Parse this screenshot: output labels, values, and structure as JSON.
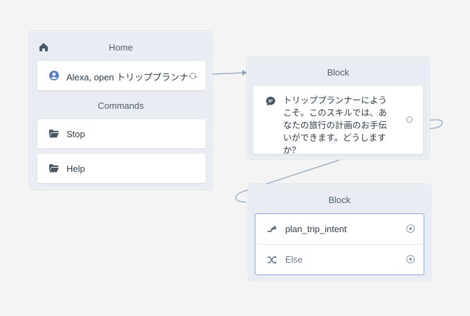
{
  "home_block": {
    "title": "Home",
    "trigger_label": "Alexa, open トリッププランナー",
    "commands_title": "Commands",
    "commands": [
      {
        "label": "Stop"
      },
      {
        "label": "Help"
      }
    ]
  },
  "speak_block": {
    "title": "Block",
    "text": "トリッププランナーにようこそ。このスキルでは、あなたの旅行の計画のお手伝いができます。どうしますか？"
  },
  "choice_block": {
    "title": "Block",
    "intent_label": "plan_trip_intent",
    "else_label": "Else"
  },
  "colors": {
    "canvas": "#f4f4f4",
    "block_bg": "#e9ecf2",
    "accent_blue": "#5b7fc7",
    "icon_dark": "#4a5866",
    "connector": "#8ea2b8"
  },
  "icons": [
    "home-icon",
    "user-icon",
    "folder-icon",
    "chat-icon",
    "intent-icon",
    "shuffle-icon"
  ]
}
